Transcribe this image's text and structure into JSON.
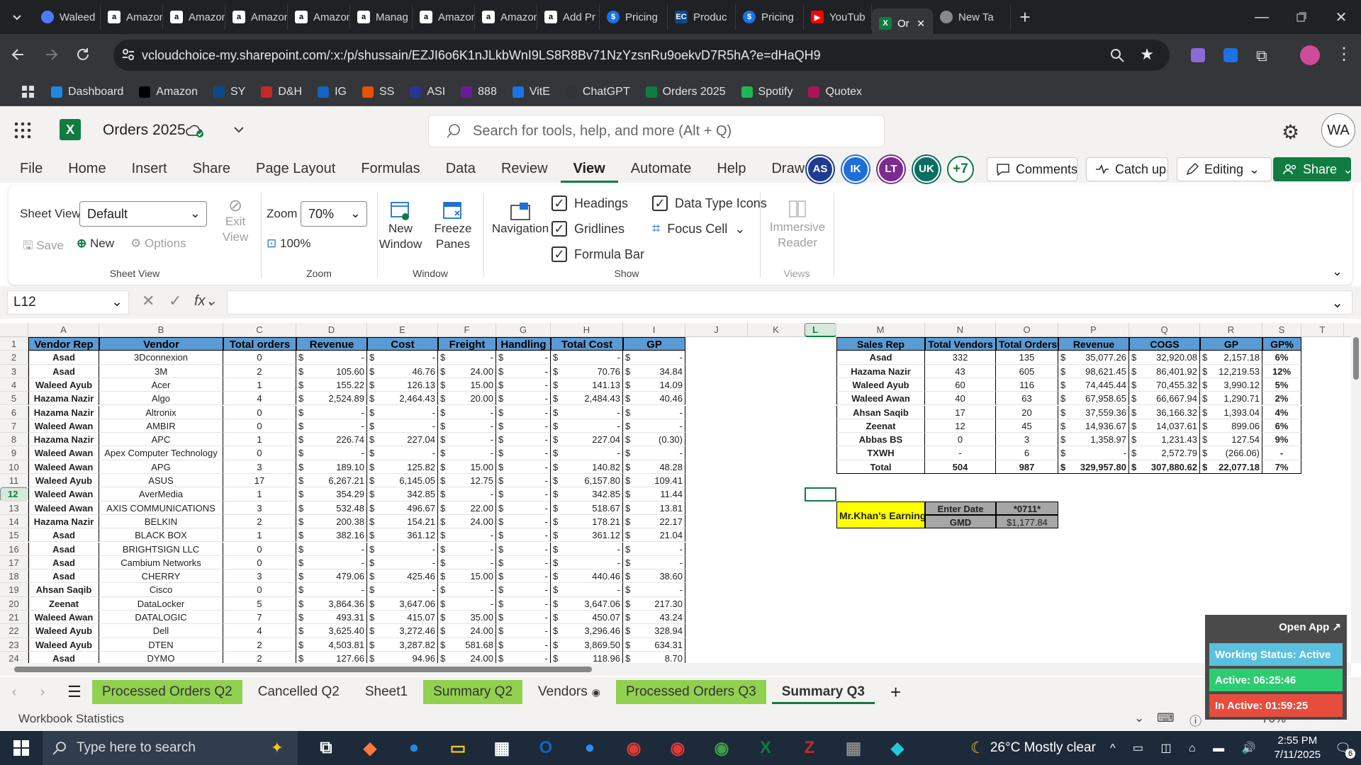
{
  "browser": {
    "tabs": [
      {
        "label": "Waleed",
        "icon": "pill",
        "color": "#4a7cff"
      },
      {
        "label": "Amazon",
        "icon": "a",
        "color": "#222"
      },
      {
        "label": "Amazon",
        "icon": "a",
        "color": "#222"
      },
      {
        "label": "Amazon",
        "icon": "a",
        "color": "#222"
      },
      {
        "label": "Amazon",
        "icon": "a",
        "color": "#222"
      },
      {
        "label": "Manag",
        "icon": "a",
        "color": "#222"
      },
      {
        "label": "Amazon",
        "icon": "a",
        "color": "#222"
      },
      {
        "label": "Amazon",
        "icon": "a",
        "color": "#222"
      },
      {
        "label": "Add Pr",
        "icon": "a",
        "color": "#222"
      },
      {
        "label": "Pricing",
        "icon": "S",
        "color": "#1a73e8"
      },
      {
        "label": "Produc",
        "icon": "EC",
        "color": "#0a4a8a"
      },
      {
        "label": "Pricing",
        "icon": "S",
        "color": "#1a73e8"
      },
      {
        "label": "YouTub",
        "icon": "yt",
        "color": "#ff0000"
      },
      {
        "label": "Or",
        "icon": "X",
        "color": "#107c41"
      },
      {
        "label": "New Ta",
        "icon": "g",
        "color": "#555"
      }
    ],
    "url": "vcloudchoice-my.sharepoint.com/:x:/p/shussain/EZJI6o6K1nJLkbWnI9LS8R8Bv71NzYzsnRu9oekvD7R5hA?e=dHaQH9",
    "bookmarks": [
      "Dashboard",
      "Amazon",
      "SY",
      "D&H",
      "IG",
      "SS",
      "ASI",
      "888",
      "VitE",
      "ChatGPT",
      "Orders 2025",
      "Spotify",
      "Quotex"
    ]
  },
  "excel": {
    "doc_title": "Orders 2025",
    "search_placeholder": "Search for tools, help, and more (Alt + Q)",
    "user_initials": "WA",
    "ribbon_tabs": [
      "File",
      "Home",
      "Insert",
      "Share",
      "Page Layout",
      "Formulas",
      "Data",
      "Review",
      "View",
      "Automate",
      "Help",
      "Draw"
    ],
    "active_tab": "View",
    "collaborators": [
      {
        "i": "AS",
        "c": "#1f3a93"
      },
      {
        "i": "IK",
        "c": "#1e6fd9"
      },
      {
        "i": "LT",
        "c": "#7b2c8f"
      },
      {
        "i": "UK",
        "c": "#0b6e5e"
      }
    ],
    "more_collab": "+7",
    "comments": "Comments",
    "catchup": "Catch up",
    "editing": "Editing",
    "share": "Share",
    "ribbon": {
      "sheet_view_label": "Sheet View",
      "sheet_view_value": "Default",
      "save": "Save",
      "new": "New",
      "options": "Options",
      "exit_view": "Exit View",
      "zoom_label": "Zoom",
      "zoom_value": "70%",
      "zoom_100": "100%",
      "new_window": "New Window",
      "freeze": "Freeze Panes",
      "navigation": "Navigation",
      "headings": "Headings",
      "gridlines": "Gridlines",
      "formula_bar": "Formula Bar",
      "data_type_icons": "Data Type Icons",
      "focus_cell": "Focus Cell",
      "immersive": "Immersive Reader",
      "grp_sheet_view": "Sheet View",
      "grp_zoom": "Zoom",
      "grp_window": "Window",
      "grp_show": "Show",
      "grp_views": "Views"
    },
    "name_box": "L12",
    "columns": [
      "A",
      "B",
      "C",
      "D",
      "E",
      "F",
      "G",
      "H",
      "I",
      "J",
      "K",
      "L",
      "M",
      "N",
      "O",
      "P",
      "Q",
      "R",
      "S",
      "T",
      "U"
    ],
    "rows": [
      "1",
      "2",
      "3",
      "4",
      "5",
      "6",
      "7",
      "8",
      "9",
      "10",
      "11",
      "12",
      "13",
      "14",
      "15",
      "16",
      "17",
      "18",
      "19",
      "20",
      "21",
      "22",
      "23",
      "24"
    ],
    "left_headers": [
      "Vendor Rep",
      "Vendor",
      "Total orders",
      "Revenue",
      "Cost",
      "Freight",
      "Handling",
      "Total Cost",
      "GP"
    ],
    "left_rows": [
      [
        "Asad",
        "3Dconnexion",
        "0",
        "-",
        "-",
        "-",
        "-",
        "-",
        "-"
      ],
      [
        "Asad",
        "3M",
        "2",
        "105.60",
        "46.76",
        "24.00",
        "-",
        "70.76",
        "34.84"
      ],
      [
        "Waleed Ayub",
        "Acer",
        "1",
        "155.22",
        "126.13",
        "15.00",
        "-",
        "141.13",
        "14.09"
      ],
      [
        "Hazama Nazir",
        "Algo",
        "4",
        "2,524.89",
        "2,464.43",
        "20.00",
        "-",
        "2,484.43",
        "40.46"
      ],
      [
        "Hazama Nazir",
        "Altronix",
        "0",
        "-",
        "-",
        "-",
        "-",
        "-",
        "-"
      ],
      [
        "Waleed Awan",
        "AMBIR",
        "0",
        "-",
        "-",
        "-",
        "-",
        "-",
        "-"
      ],
      [
        "Hazama Nazir",
        "APC",
        "1",
        "226.74",
        "227.04",
        "-",
        "-",
        "227.04",
        "(0.30)"
      ],
      [
        "Waleed Awan",
        "Apex Computer Technology",
        "0",
        "-",
        "-",
        "-",
        "-",
        "-",
        "-"
      ],
      [
        "Waleed Awan",
        "APG",
        "3",
        "189.10",
        "125.82",
        "15.00",
        "-",
        "140.82",
        "48.28"
      ],
      [
        "Waleed Ayub",
        "ASUS",
        "17",
        "6,267.21",
        "6,145.05",
        "12.75",
        "-",
        "6,157.80",
        "109.41"
      ],
      [
        "Waleed Awan",
        "AverMedia",
        "1",
        "354.29",
        "342.85",
        "-",
        "-",
        "342.85",
        "11.44"
      ],
      [
        "Waleed Awan",
        "AXIS COMMUNICATIONS",
        "3",
        "532.48",
        "496.67",
        "22.00",
        "-",
        "518.67",
        "13.81"
      ],
      [
        "Hazama Nazir",
        "BELKIN",
        "2",
        "200.38",
        "154.21",
        "24.00",
        "-",
        "178.21",
        "22.17"
      ],
      [
        "Asad",
        "BLACK BOX",
        "1",
        "382.16",
        "361.12",
        "-",
        "-",
        "361.12",
        "21.04"
      ],
      [
        "Asad",
        "BRIGHTSIGN LLC",
        "0",
        "-",
        "-",
        "-",
        "-",
        "-",
        "-"
      ],
      [
        "Asad",
        "Cambium Networks",
        "0",
        "-",
        "-",
        "-",
        "-",
        "-",
        "-"
      ],
      [
        "Asad",
        "CHERRY",
        "3",
        "479.06",
        "425.46",
        "15.00",
        "-",
        "440.46",
        "38.60"
      ],
      [
        "Ahsan Saqib",
        "Cisco",
        "0",
        "-",
        "-",
        "-",
        "-",
        "-",
        "-"
      ],
      [
        "Zeenat",
        "DataLocker",
        "5",
        "3,864.36",
        "3,647.06",
        "-",
        "-",
        "3,647.06",
        "217.30"
      ],
      [
        "Waleed Awan",
        "DATALOGIC",
        "7",
        "493.31",
        "415.07",
        "35.00",
        "-",
        "450.07",
        "43.24"
      ],
      [
        "Waleed Ayub",
        "Dell",
        "4",
        "3,625.40",
        "3,272.46",
        "24.00",
        "-",
        "3,296.46",
        "328.94"
      ],
      [
        "Waleed Ayub",
        "DTEN",
        "2",
        "4,503.81",
        "3,287.82",
        "581.68",
        "-",
        "3,869.50",
        "634.31"
      ],
      [
        "Asad",
        "DYMO",
        "2",
        "127.66",
        "94.96",
        "24.00",
        "-",
        "118.96",
        "8.70"
      ]
    ],
    "summary_headers": [
      "Sales Rep",
      "Total Vendors",
      "Total Orders",
      "Revenue",
      "COGS",
      "GP",
      "GP%"
    ],
    "summary_rows": [
      [
        "Asad",
        "332",
        "135",
        "35,077.26",
        "32,920.08",
        "2,157.18",
        "6%"
      ],
      [
        "Hazama Nazir",
        "43",
        "605",
        "98,621.45",
        "86,401.92",
        "12,219.53",
        "12%"
      ],
      [
        "Waleed Ayub",
        "60",
        "116",
        "74,445.44",
        "70,455.32",
        "3,990.12",
        "5%"
      ],
      [
        "Waleed Awan",
        "40",
        "63",
        "67,958.65",
        "66,667.94",
        "1,290.71",
        "2%"
      ],
      [
        "Ahsan Saqib",
        "17",
        "20",
        "37,559.36",
        "36,166.32",
        "1,393.04",
        "4%"
      ],
      [
        "Zeenat",
        "12",
        "45",
        "14,936.67",
        "14,037.61",
        "899.06",
        "6%"
      ],
      [
        "Abbas BS",
        "0",
        "3",
        "1,358.97",
        "1,231.43",
        "127.54",
        "9%"
      ],
      [
        "TXWH",
        "-",
        "6",
        "-",
        "2,572.79",
        "(266.06)",
        "-"
      ]
    ],
    "summary_total": [
      "Total",
      "504",
      "987",
      "329,957.80",
      "307,880.62",
      "22,077.18",
      "7%"
    ],
    "earning": {
      "label": "Mr.Khan's Earning",
      "date_label": "Enter Date",
      "date_value": "*0711*",
      "gmd_label": "GMD",
      "gmd_value": "$1,177.84"
    },
    "sheet_tabs": [
      {
        "label": "Processed Orders Q2",
        "green": true
      },
      {
        "label": "Cancelled Q2",
        "green": false
      },
      {
        "label": "Sheet1",
        "green": false
      },
      {
        "label": "Summary Q2",
        "green": true
      },
      {
        "label": "Vendors",
        "green": false
      },
      {
        "label": "Processed Orders Q3",
        "green": true
      },
      {
        "label": "Summary Q3",
        "green": false,
        "active": true
      }
    ],
    "status": "Workbook Statistics",
    "zoom_status": "70%"
  },
  "widget": {
    "open_app": "Open App",
    "working": "Working Status: Active",
    "active": "Active: 06:25:46",
    "inactive": "In Active: 01:59:25"
  },
  "taskbar": {
    "search": "Type here to search",
    "weather": "26°C  Mostly clear",
    "time": "2:55 PM",
    "date": "7/11/2025",
    "notif": "6"
  },
  "colors": {
    "excel_green": "#107c41",
    "header_blue": "#5b9bd5",
    "tab_green": "#92d050",
    "earning_yellow": "#ffff00"
  }
}
